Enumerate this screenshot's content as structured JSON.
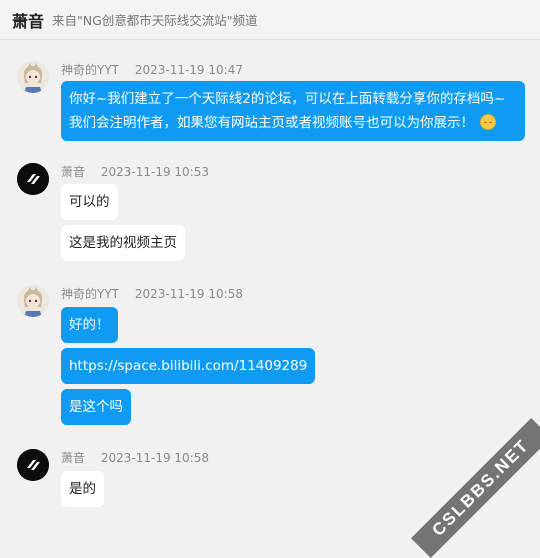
{
  "header": {
    "title": "萧音",
    "subtitle": "来自\"NG创意都市天际线交流站\"频道"
  },
  "messages": [
    {
      "sender": "神奇的YYT",
      "time": "2023-11-19 10:47",
      "lines": [
        "你好~我们建立了一个天际线2的论坛，可以在上面转载分享你的存档吗~",
        "我们会注明作者，如果您有网站主页或者视频账号也可以为你展示！"
      ]
    },
    {
      "sender": "萧音",
      "time": "2023-11-19 10:53",
      "bubbles": [
        "可以的",
        "这是我的视频主页"
      ]
    },
    {
      "sender": "神奇的YYT",
      "time": "2023-11-19 10:58",
      "bubbles": [
        "好的！",
        "https://space.bilibili.com/11409289",
        "是这个吗"
      ]
    },
    {
      "sender": "萧音",
      "time": "2023-11-19 10:58",
      "bubbles": [
        "是的"
      ]
    }
  ],
  "watermark": "CSLBBS.NET"
}
